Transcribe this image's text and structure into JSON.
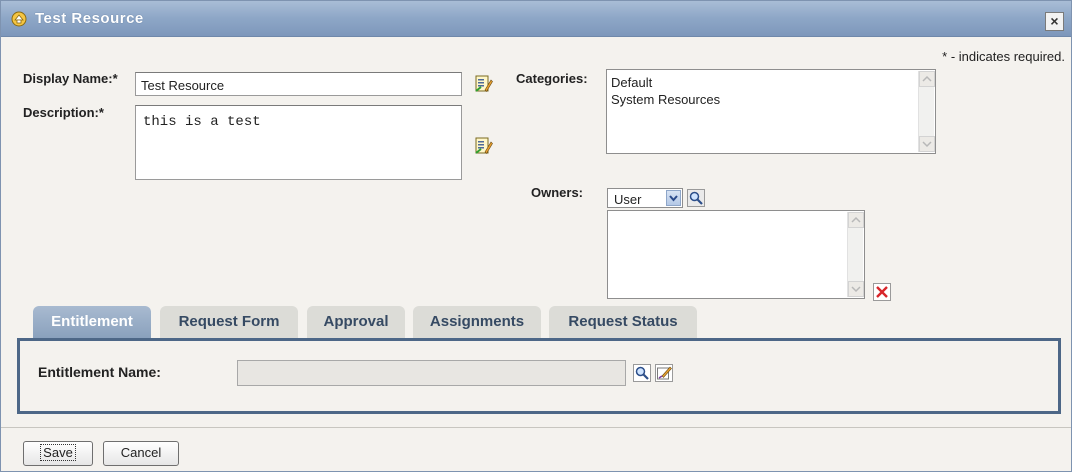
{
  "window": {
    "title": "Test Resource",
    "close_label": "×"
  },
  "required_note": "* - indicates required.",
  "form": {
    "display_name": {
      "label": "Display Name:*",
      "value": "Test Resource"
    },
    "description": {
      "label": "Description:*",
      "value": "this is a test"
    },
    "categories": {
      "label": "Categories:",
      "items": [
        "Default",
        "System Resources"
      ]
    },
    "owners": {
      "label": "Owners:",
      "type_selected": "User",
      "items": []
    }
  },
  "tabs": [
    {
      "label": "Entitlement",
      "active": true
    },
    {
      "label": "Request Form",
      "active": false
    },
    {
      "label": "Approval",
      "active": false
    },
    {
      "label": "Assignments",
      "active": false
    },
    {
      "label": "Request Status",
      "active": false
    }
  ],
  "entitlement": {
    "label": "Entitlement Name:",
    "value": ""
  },
  "buttons": {
    "save": "Save",
    "cancel": "Cancel"
  },
  "icons": {
    "title": "resource-icon",
    "edit": "localize-edit-icon",
    "search": "magnifier-icon",
    "delete": "red-x-icon",
    "edit_entitlement": "pencil-icon"
  },
  "colors": {
    "titlebar": "#8ea7c7",
    "active_tab": "#8aa1bd",
    "inactive_tab": "#dcdcd7",
    "tab_text": "#364a63",
    "panel_border": "#4d6787",
    "background": "#f4f2ee"
  }
}
